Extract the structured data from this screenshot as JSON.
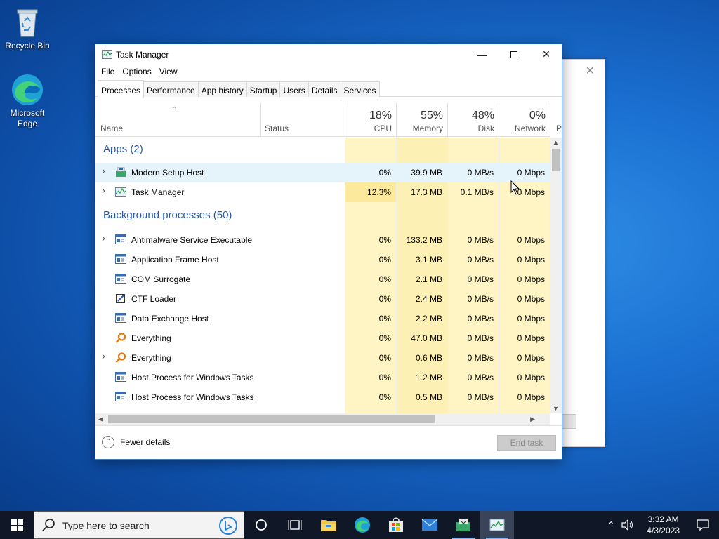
{
  "desktop": {
    "icons": [
      {
        "label": "Recycle Bin",
        "icon": "recycle-bin-icon"
      },
      {
        "label": "Microsoft Edge",
        "icon": "edge-icon"
      }
    ]
  },
  "window": {
    "title": "Task Manager",
    "menu": [
      "File",
      "Options",
      "View"
    ],
    "tabs": [
      "Processes",
      "Performance",
      "App history",
      "Startup",
      "Users",
      "Details",
      "Services"
    ],
    "active_tab": "Processes"
  },
  "columns": {
    "name": "Name",
    "status": "Status",
    "cpu": {
      "pct": "18%",
      "label": "CPU"
    },
    "memory": {
      "pct": "55%",
      "label": "Memory"
    },
    "disk": {
      "pct": "48%",
      "label": "Disk"
    },
    "network": {
      "pct": "0%",
      "label": "Network"
    },
    "power_partial": "P"
  },
  "groups": {
    "apps": "Apps (2)",
    "background": "Background processes (50)"
  },
  "apps": [
    {
      "name": "Modern Setup Host",
      "cpu": "0%",
      "memory": "39.9 MB",
      "disk": "0 MB/s",
      "network": "0 Mbps",
      "expandable": true,
      "icon": "setup-host-icon"
    },
    {
      "name": "Task Manager",
      "cpu": "12.3%",
      "memory": "17.3 MB",
      "disk": "0.1 MB/s",
      "network": "0 Mbps",
      "expandable": true,
      "icon": "task-manager-icon"
    }
  ],
  "background": [
    {
      "name": "Antimalware Service Executable",
      "cpu": "0%",
      "memory": "133.2 MB",
      "disk": "0 MB/s",
      "network": "0 Mbps",
      "expandable": true,
      "icon": "service-icon"
    },
    {
      "name": "Application Frame Host",
      "cpu": "0%",
      "memory": "3.1 MB",
      "disk": "0 MB/s",
      "network": "0 Mbps",
      "expandable": false,
      "icon": "service-icon"
    },
    {
      "name": "COM Surrogate",
      "cpu": "0%",
      "memory": "2.1 MB",
      "disk": "0 MB/s",
      "network": "0 Mbps",
      "expandable": false,
      "icon": "service-icon"
    },
    {
      "name": "CTF Loader",
      "cpu": "0%",
      "memory": "2.4 MB",
      "disk": "0 MB/s",
      "network": "0 Mbps",
      "expandable": false,
      "icon": "ctf-icon"
    },
    {
      "name": "Data Exchange Host",
      "cpu": "0%",
      "memory": "2.2 MB",
      "disk": "0 MB/s",
      "network": "0 Mbps",
      "expandable": false,
      "icon": "service-icon"
    },
    {
      "name": "Everything",
      "cpu": "0%",
      "memory": "47.0 MB",
      "disk": "0 MB/s",
      "network": "0 Mbps",
      "expandable": false,
      "icon": "everything-icon"
    },
    {
      "name": "Everything",
      "cpu": "0%",
      "memory": "0.6 MB",
      "disk": "0 MB/s",
      "network": "0 Mbps",
      "expandable": true,
      "icon": "everything-icon"
    },
    {
      "name": "Host Process for Windows Tasks",
      "cpu": "0%",
      "memory": "1.2 MB",
      "disk": "0 MB/s",
      "network": "0 Mbps",
      "expandable": false,
      "icon": "service-icon"
    },
    {
      "name": "Host Process for Windows Tasks",
      "cpu": "0%",
      "memory": "0.5 MB",
      "disk": "0 MB/s",
      "network": "0 Mbps",
      "expandable": false,
      "icon": "service-icon"
    }
  ],
  "footer": {
    "fewer_details": "Fewer details",
    "end_task": "End task"
  },
  "taskbar": {
    "search_placeholder": "Type here to search",
    "items": [
      "cortana-icon",
      "task-view-icon",
      "file-explorer-icon",
      "edge-icon",
      "store-icon",
      "mail-icon",
      "setup-icon",
      "task-manager-icon"
    ],
    "time": "3:32 AM",
    "date": "4/3/2023"
  },
  "colors": {
    "cpu_high": "#fde99b",
    "col_light": "#fff4c4",
    "col_mid": "#fdf0b5",
    "group_text": "#2a5aa6",
    "taskbar": "#101828"
  }
}
